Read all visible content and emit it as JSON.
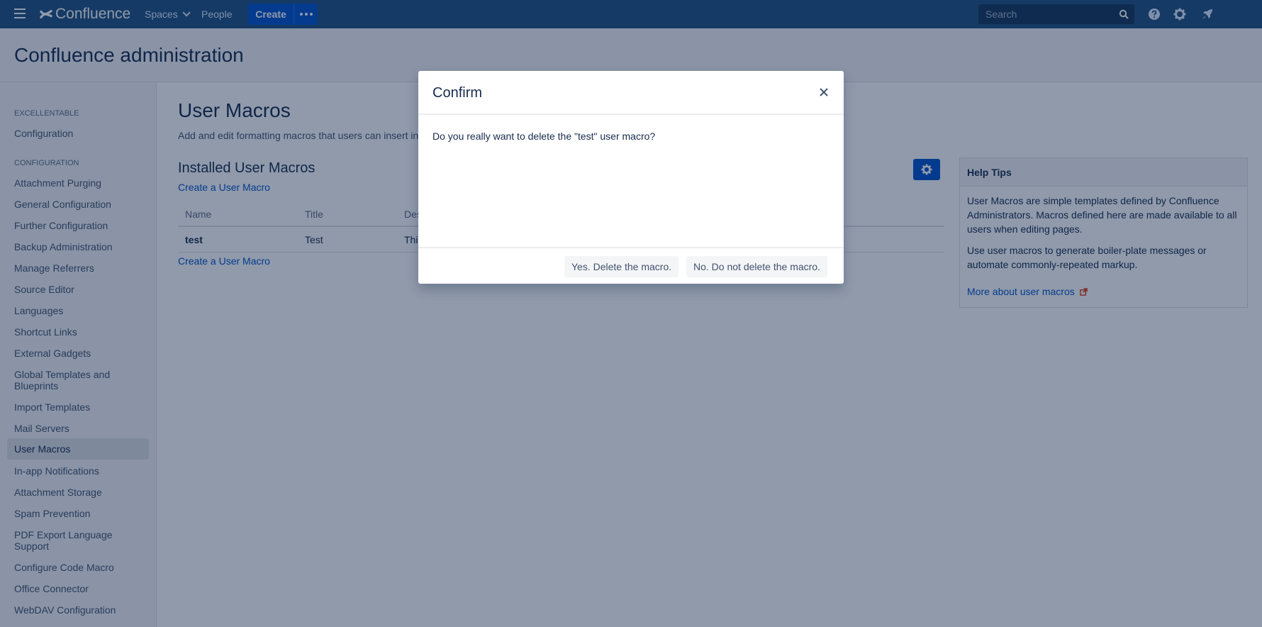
{
  "topnav": {
    "brand": "Confluence",
    "spaces": "Spaces",
    "people": "People",
    "create": "Create",
    "search_placeholder": "Search"
  },
  "header": {
    "title": "Confluence administration"
  },
  "sidebar": {
    "group1": "EXCELLENTABLE",
    "group1_items": [
      "Configuration"
    ],
    "group2": "CONFIGURATION",
    "items": [
      "Attachment Purging",
      "General Configuration",
      "Further Configuration",
      "Backup Administration",
      "Manage Referrers",
      "Source Editor",
      "Languages",
      "Shortcut Links",
      "External Gadgets",
      "Global Templates and Blueprints",
      "Import Templates",
      "Mail Servers",
      "User Macros",
      "In-app Notifications",
      "Attachment Storage",
      "Spam Prevention",
      "PDF Export Language Support",
      "Configure Code Macro",
      "Office Connector",
      "WebDAV Configuration"
    ],
    "active": "User Macros"
  },
  "main": {
    "title": "User Macros",
    "description": "Add and edit formatting macros that users can insert in",
    "section_title": "Installed User Macros",
    "create_link": "Create a User Macro",
    "columns": [
      "Name",
      "Title",
      "Des"
    ],
    "rows": [
      {
        "name": "test",
        "title": "Test",
        "description": "Thi"
      }
    ]
  },
  "help": {
    "title": "Help Tips",
    "p1": "User Macros are simple templates defined by Confluence Administrators. Macros defined here are made available to all users when editing pages.",
    "p2": "Use user macros to generate boiler-plate messages or automate commonly-repeated markup.",
    "link": "More about user macros"
  },
  "dialog": {
    "title": "Confirm",
    "message": "Do you really want to delete the \"test\" user macro?",
    "confirm": "Yes. Delete the macro.",
    "cancel": "No. Do not delete the macro."
  },
  "colors": {
    "nav": "#205081",
    "primary": "#0052cc",
    "link": "#0052cc"
  }
}
